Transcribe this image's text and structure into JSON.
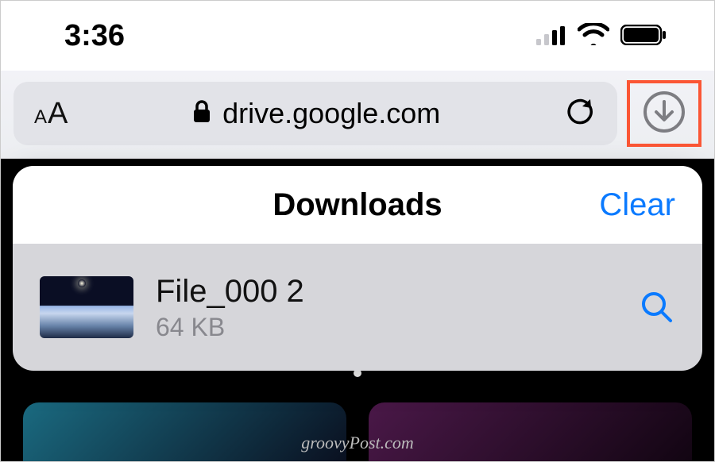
{
  "status_bar": {
    "time": "3:36"
  },
  "address_bar": {
    "url": "drive.google.com"
  },
  "downloads_popover": {
    "title": "Downloads",
    "clear_label": "Clear",
    "items": [
      {
        "name": "File_000 2",
        "size": "64 KB"
      }
    ]
  },
  "watermark": "groovyPost.com"
}
